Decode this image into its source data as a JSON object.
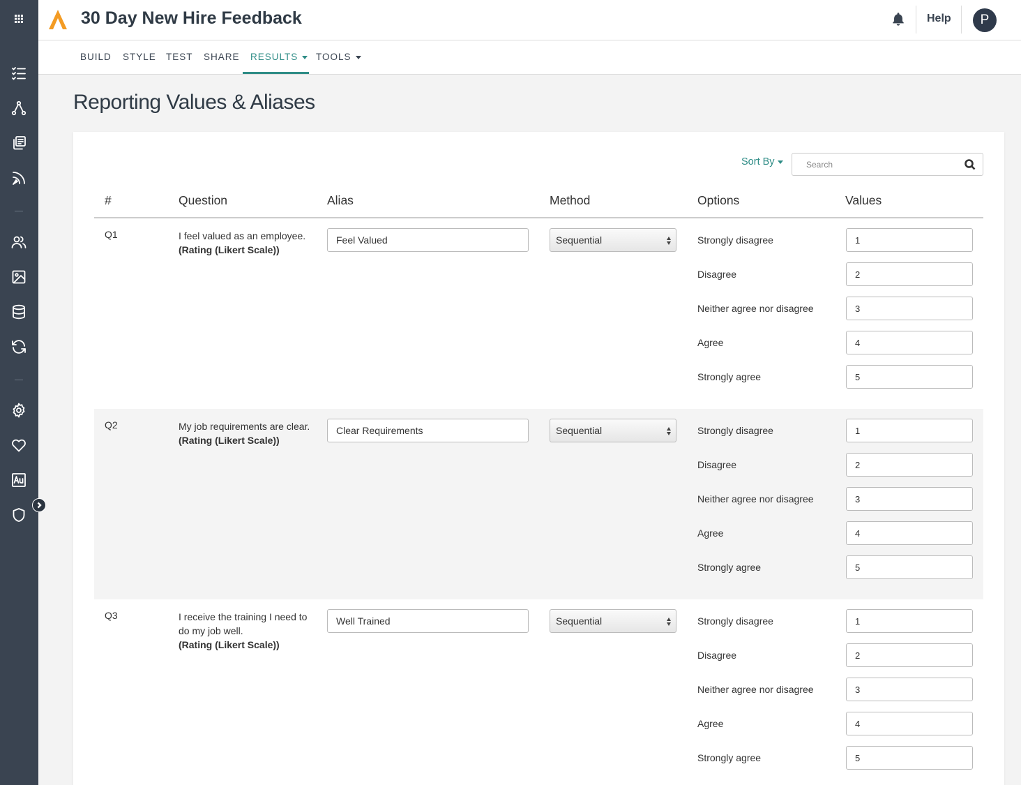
{
  "app": {
    "survey_title": "30 Day New Hire Feedback",
    "help_label": "Help",
    "avatar_initial": "P"
  },
  "nav": {
    "tabs": [
      {
        "label": "BUILD"
      },
      {
        "label": "STYLE"
      },
      {
        "label": "TEST"
      },
      {
        "label": "SHARE"
      },
      {
        "label": "RESULTS",
        "active": true,
        "dropdown": true
      },
      {
        "label": "TOOLS",
        "dropdown": true
      }
    ]
  },
  "page": {
    "title": "Reporting Values & Aliases"
  },
  "toolbar": {
    "sort_label": "Sort By",
    "search_placeholder": "Search"
  },
  "table": {
    "headers": [
      "#",
      "Question",
      "Alias",
      "Method",
      "Options",
      "Values"
    ],
    "rows": [
      {
        "num": "Q1",
        "question": "I feel valued as an employee.",
        "type": "(Rating (Likert Scale))",
        "alias": "Feel Valued",
        "method": "Sequential",
        "options": [
          {
            "label": "Strongly disagree",
            "value": "1"
          },
          {
            "label": "Disagree",
            "value": "2"
          },
          {
            "label": "Neither agree nor disagree",
            "value": "3"
          },
          {
            "label": "Agree",
            "value": "4"
          },
          {
            "label": "Strongly agree",
            "value": "5"
          }
        ]
      },
      {
        "num": "Q2",
        "question": "My job requirements are clear.",
        "type": "(Rating (Likert Scale))",
        "alias": "Clear Requirements",
        "method": "Sequential",
        "options": [
          {
            "label": "Strongly disagree",
            "value": "1"
          },
          {
            "label": "Disagree",
            "value": "2"
          },
          {
            "label": "Neither agree nor disagree",
            "value": "3"
          },
          {
            "label": "Agree",
            "value": "4"
          },
          {
            "label": "Strongly agree",
            "value": "5"
          }
        ]
      },
      {
        "num": "Q3",
        "question": "I receive the training I need to do my job well.",
        "type": "(Rating (Likert Scale))",
        "alias": "Well Trained",
        "method": "Sequential",
        "options": [
          {
            "label": "Strongly disagree",
            "value": "1"
          },
          {
            "label": "Disagree",
            "value": "2"
          },
          {
            "label": "Neither agree nor disagree",
            "value": "3"
          },
          {
            "label": "Agree",
            "value": "4"
          },
          {
            "label": "Strongly agree",
            "value": "5"
          }
        ]
      }
    ]
  },
  "sidebar": {
    "icons": [
      "checklist-icon",
      "workflow-icon",
      "pages-icon",
      "rss-icon",
      "users-icon",
      "image-icon",
      "database-icon",
      "sync-icon",
      "gear-icon",
      "heart-icon",
      "au-icon",
      "shield-icon"
    ]
  },
  "colors": {
    "accent": "#2e8c86",
    "rail": "#3a4451",
    "logo": "#f39b23"
  }
}
